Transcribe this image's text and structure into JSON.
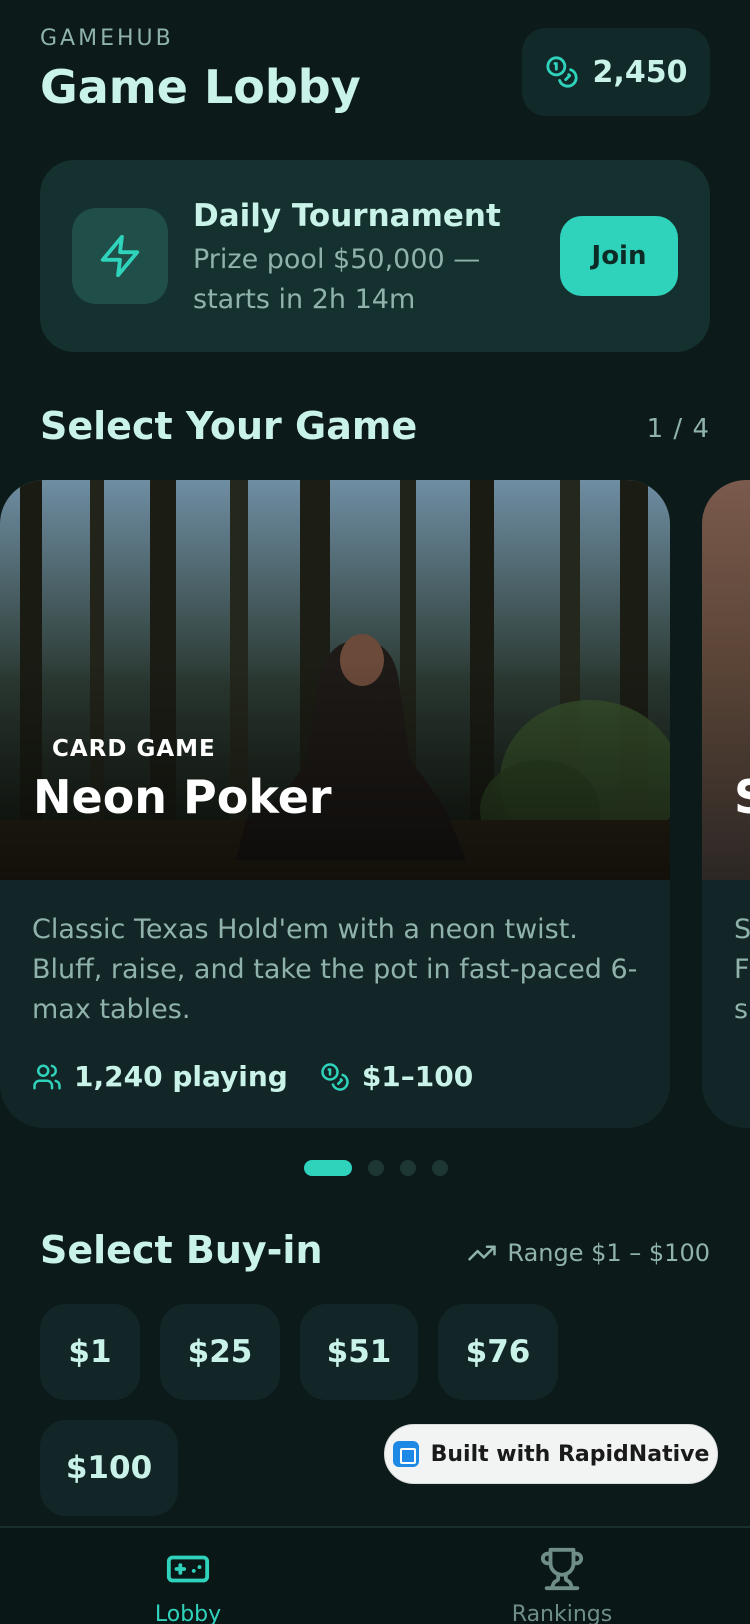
{
  "header": {
    "brand": "GAMEHUB",
    "title": "Game Lobby",
    "coins": "2,450",
    "coin_icon": "coins-icon"
  },
  "tournament": {
    "title": "Daily Tournament",
    "subtitle": "Prize pool $50,000 — starts in 2h 14m",
    "join_label": "Join",
    "icon": "lightning-icon"
  },
  "game_section": {
    "title": "Select Your Game",
    "pager": "1 / 4"
  },
  "featured_game": {
    "tag": "CARD GAME",
    "name": "Neon Poker",
    "description": "Classic Texas Hold'em with a neon twist. Bluff, raise, and take the pot in fast-paced 6-max tables.",
    "players": "1,240 playing",
    "stakes": "$1–100"
  },
  "next_game_peek": {
    "name_initial": "S",
    "desc_lines": [
      "S",
      "F",
      "s"
    ]
  },
  "carousel": {
    "count": 4,
    "active": 0
  },
  "buyin_section": {
    "title": "Select Buy-in",
    "range": "Range $1 – $100",
    "options": [
      "$1",
      "$25",
      "$51",
      "$76",
      "$100"
    ]
  },
  "badge": {
    "label": "Built with RapidNative"
  },
  "nav": {
    "items": [
      "Lobby",
      "Rankings"
    ],
    "active": "Lobby"
  },
  "colors": {
    "accent": "#2fd3bc",
    "background": "#0c1a1a",
    "card": "#132627",
    "text": "#c9f2e8",
    "muted": "#8fb2ac"
  }
}
